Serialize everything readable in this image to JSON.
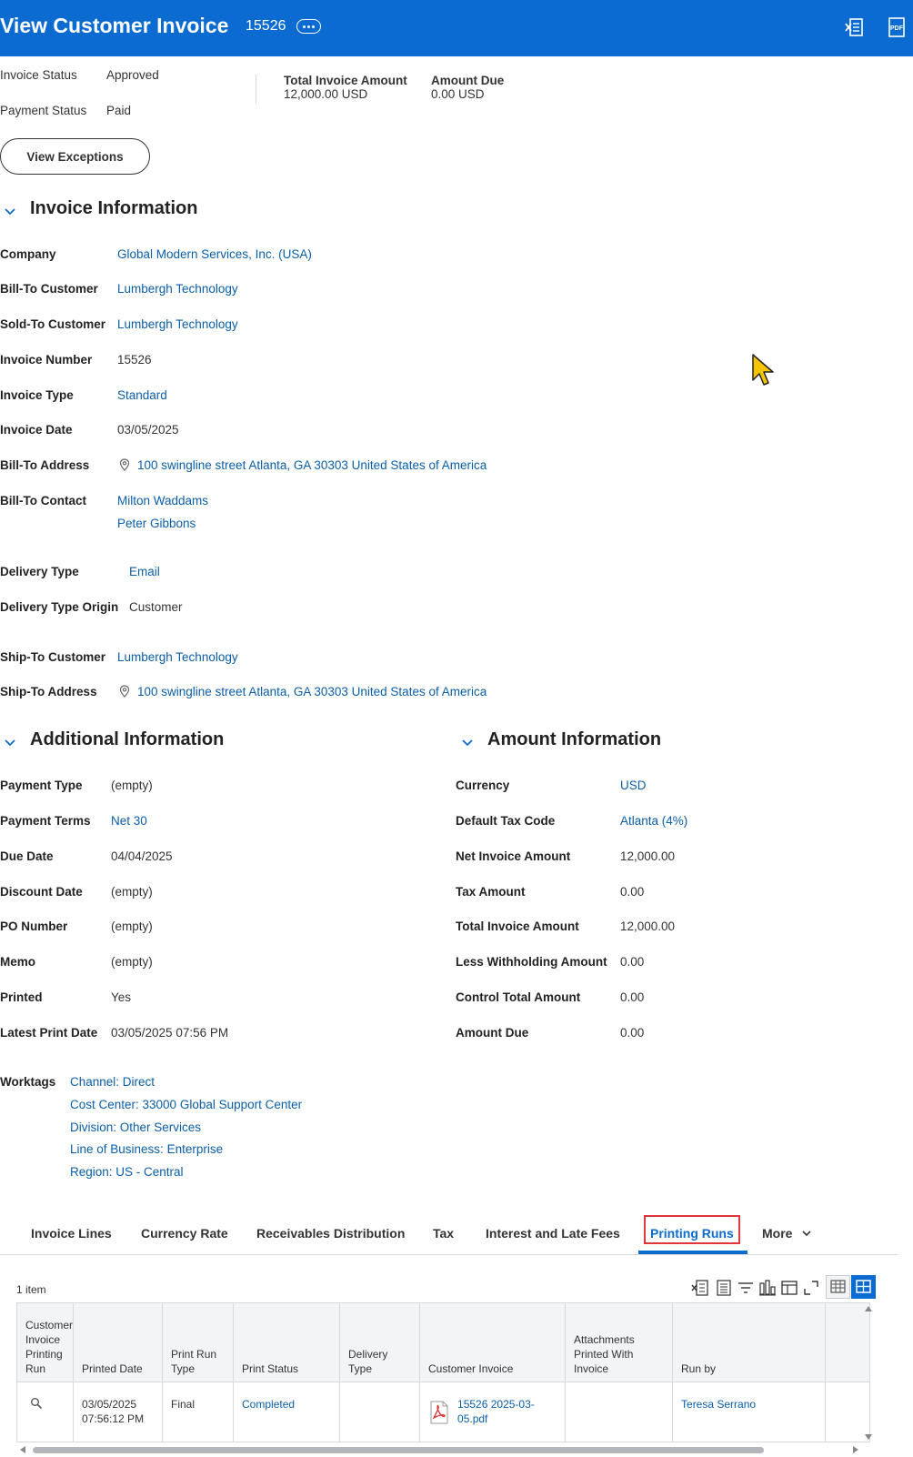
{
  "header": {
    "title": "View Customer Invoice",
    "invoice_number": "15526",
    "related_actions_icon": "ellipsis-icon",
    "excel_icon": "excel-export-icon",
    "pdf_icon": "pdf-export-icon",
    "pdf_label": "PDF",
    "background_color": "#0b6bd0"
  },
  "status": {
    "invoice_status_label": "Invoice Status",
    "invoice_status_value": "Approved",
    "payment_status_label": "Payment Status",
    "payment_status_value": "Paid",
    "total_invoice_amount_label": "Total Invoice Amount",
    "total_invoice_amount_value": "12,000.00 USD",
    "amount_due_label": "Amount Due",
    "amount_due_value": "0.00 USD",
    "view_exceptions_label": "View Exceptions"
  },
  "invoice_info": {
    "heading": "Invoice Information",
    "company_label": "Company",
    "company_value": "Global Modern Services, Inc. (USA)",
    "bill_to_customer_label": "Bill-To Customer",
    "bill_to_customer_value": "Lumbergh Technology",
    "sold_to_customer_label": "Sold-To Customer",
    "sold_to_customer_value": "Lumbergh Technology",
    "invoice_number_label": "Invoice Number",
    "invoice_number_value": "15526",
    "invoice_type_label": "Invoice Type",
    "invoice_type_value": "Standard",
    "invoice_date_label": "Invoice Date",
    "invoice_date_value": "03/05/2025",
    "bill_to_address_label": "Bill-To Address",
    "bill_to_address_value": "100 swingline street Atlanta, GA 30303 United States of America",
    "bill_to_contact_label": "Bill-To Contact",
    "bill_to_contacts": [
      "Milton Waddams",
      "Peter Gibbons"
    ],
    "delivery_type_label": "Delivery Type",
    "delivery_type_value": "Email",
    "delivery_type_origin_label": "Delivery Type Origin",
    "delivery_type_origin_value": "Customer",
    "ship_to_customer_label": "Ship-To Customer",
    "ship_to_customer_value": "Lumbergh Technology",
    "ship_to_address_label": "Ship-To Address",
    "ship_to_address_value": "100 swingline street Atlanta, GA 30303 United States of America"
  },
  "additional_info": {
    "heading": "Additional Information",
    "payment_type_label": "Payment Type",
    "payment_type_value": "(empty)",
    "payment_terms_label": "Payment Terms",
    "payment_terms_value": "Net 30",
    "due_date_label": "Due Date",
    "due_date_value": "04/04/2025",
    "discount_date_label": "Discount Date",
    "discount_date_value": "(empty)",
    "po_number_label": "PO Number",
    "po_number_value": "(empty)",
    "memo_label": "Memo",
    "memo_value": "(empty)",
    "printed_label": "Printed",
    "printed_value": "Yes",
    "latest_print_date_label": "Latest Print Date",
    "latest_print_date_value": "03/05/2025 07:56 PM",
    "worktags_label": "Worktags",
    "worktags": [
      "Channel: Direct",
      "Cost Center: 33000 Global Support Center",
      "Division: Other Services",
      "Line of Business: Enterprise",
      "Region: US - Central"
    ]
  },
  "amount_info": {
    "heading": "Amount Information",
    "currency_label": "Currency",
    "currency_value": "USD",
    "default_tax_code_label": "Default Tax Code",
    "default_tax_code_value": "Atlanta (4%)",
    "net_invoice_amount_label": "Net Invoice Amount",
    "net_invoice_amount_value": "12,000.00",
    "tax_amount_label": "Tax Amount",
    "tax_amount_value": "0.00",
    "total_invoice_amount_label": "Total Invoice Amount",
    "total_invoice_amount_value": "12,000.00",
    "less_withholding_label": "Less Withholding Amount",
    "less_withholding_value": "0.00",
    "control_total_label": "Control Total Amount",
    "control_total_value": "0.00",
    "amount_due_label": "Amount Due",
    "amount_due_value": "0.00"
  },
  "tabs": {
    "items": [
      "Invoice Lines",
      "Currency Rate",
      "Receivables Distribution",
      "Tax",
      "Interest and Late Fees",
      "Printing Runs",
      "More"
    ],
    "active": "Printing Runs",
    "highlight_color": "#e0353b"
  },
  "grid": {
    "item_count": "1 item",
    "toolbar_icons": [
      "excel-export-icon",
      "print-icon",
      "filter-icon",
      "chart-icon",
      "column-layout-icon",
      "fullscreen-icon",
      "table-view-icon",
      "grid-view-icon"
    ],
    "columns": [
      "Customer Invoice Printing Run",
      "Printed Date",
      "Print Run Type",
      "Print Status",
      "Delivery Type",
      "Customer Invoice",
      "Attachments Printed With Invoice",
      "Run by"
    ],
    "rows": [
      {
        "run_icon": "magnifier-icon",
        "printed_date": "03/05/2025 07:56:12 PM",
        "print_run_type": "Final",
        "print_status": "Completed",
        "delivery_type": "",
        "customer_invoice": "15526 2025-03-05.pdf",
        "attachments": "",
        "run_by": "Teresa Serrano"
      }
    ]
  }
}
